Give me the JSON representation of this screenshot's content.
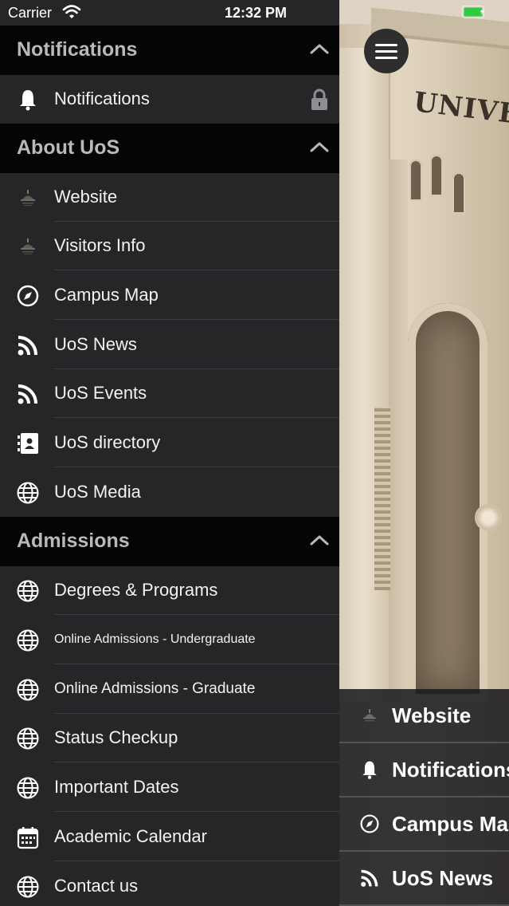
{
  "status_bar": {
    "carrier": "Carrier",
    "time": "12:32 PM",
    "battery_color": "#2ecc40"
  },
  "drawer": {
    "sections": [
      {
        "title": "Notifications",
        "items": [
          {
            "label": "Notifications",
            "icon": "bell-icon",
            "locked": true
          }
        ]
      },
      {
        "title": "About UoS",
        "items": [
          {
            "label": "Website",
            "icon": "uos-logo-icon"
          },
          {
            "label": "Visitors Info",
            "icon": "uos-logo-icon"
          },
          {
            "label": "Campus Map",
            "icon": "compass-icon"
          },
          {
            "label": "UoS News",
            "icon": "rss-icon"
          },
          {
            "label": "UoS Events",
            "icon": "rss-icon"
          },
          {
            "label": "UoS directory",
            "icon": "contact-book-icon"
          },
          {
            "label": "UoS Media",
            "icon": "globe-icon"
          }
        ]
      },
      {
        "title": "Admissions",
        "items": [
          {
            "label": "Degrees & Programs",
            "icon": "globe-icon"
          },
          {
            "label": "Online Admissions - Undergraduate",
            "icon": "globe-icon"
          },
          {
            "label": "Online Admissions - Graduate",
            "icon": "globe-icon"
          },
          {
            "label": "Status Checkup",
            "icon": "globe-icon"
          },
          {
            "label": "Important Dates",
            "icon": "globe-icon"
          },
          {
            "label": "Academic Calendar",
            "icon": "calendar-icon"
          },
          {
            "label": "Contact us",
            "icon": "globe-icon"
          }
        ]
      }
    ]
  },
  "background": {
    "building_text": "UNIVERSIT"
  },
  "quick_tiles": [
    {
      "label": "Website",
      "icon": "uos-logo-icon"
    },
    {
      "label": "Notifications",
      "icon": "bell-icon"
    },
    {
      "label": "Campus Map",
      "icon": "compass-icon"
    },
    {
      "label": "UoS News",
      "icon": "rss-icon"
    }
  ]
}
